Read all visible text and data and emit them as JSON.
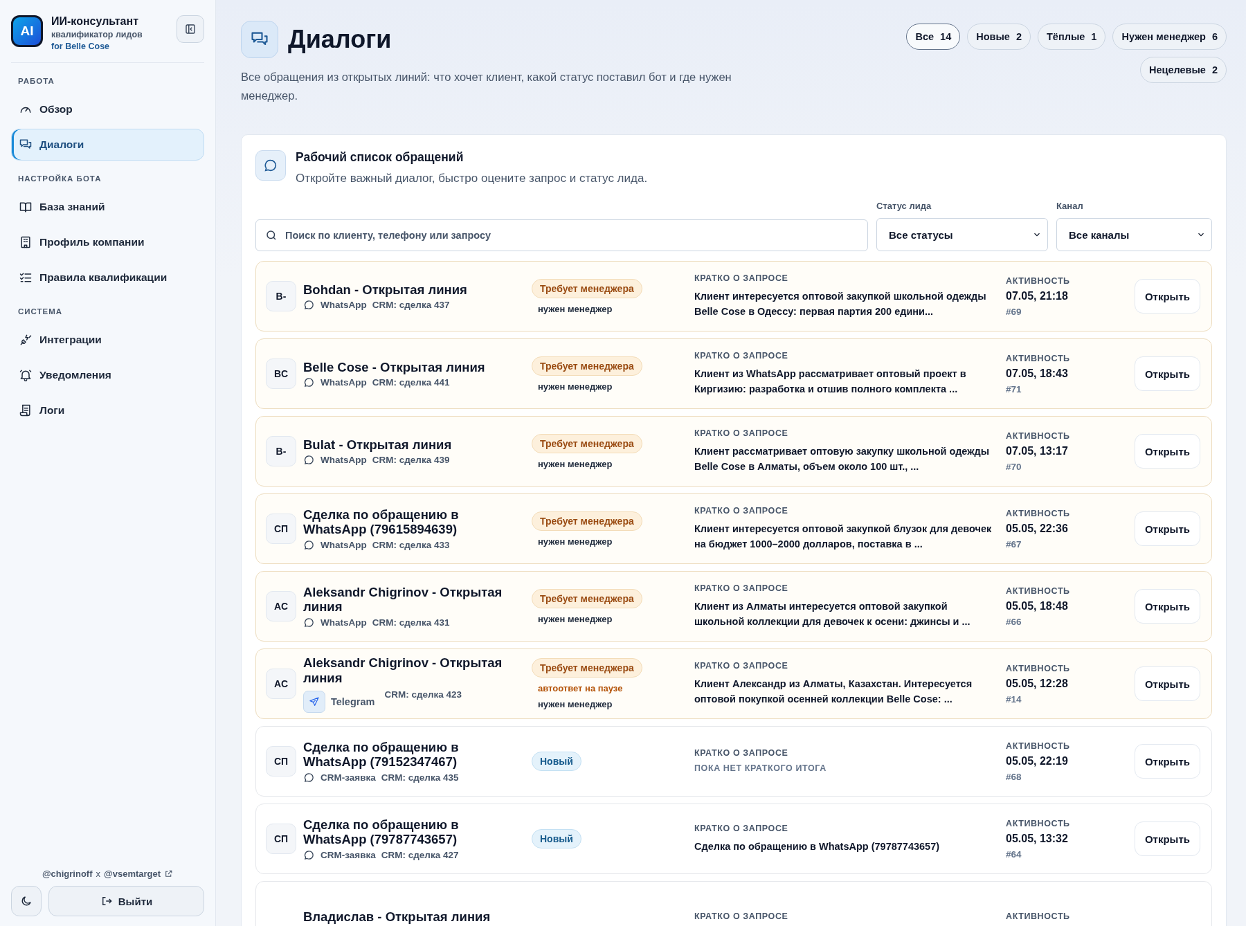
{
  "brand": {
    "badge": "AI",
    "title": "ИИ-консультант",
    "subtitle": "квалификатор лидов",
    "client": "for Belle Cose"
  },
  "sidebar": {
    "sections": [
      {
        "heading": "РАБОТА",
        "items": [
          {
            "label": "Обзор",
            "selected": false
          },
          {
            "label": "Диалоги",
            "selected": true
          }
        ]
      },
      {
        "heading": "НАСТРОЙКА БОТА",
        "items": [
          {
            "label": "База знаний",
            "selected": false
          },
          {
            "label": "Профиль компании",
            "selected": false
          },
          {
            "label": "Правила квалификации",
            "selected": false
          }
        ]
      },
      {
        "heading": "СИСТЕМА",
        "items": [
          {
            "label": "Интеграции",
            "selected": false
          },
          {
            "label": "Уведомления",
            "selected": false
          },
          {
            "label": "Логи",
            "selected": false
          }
        ]
      }
    ],
    "credits": {
      "left": "@chigrinoff",
      "sep": "x",
      "right": "@vsemtarget"
    },
    "logout": "Выйти"
  },
  "header": {
    "title": "Диалоги",
    "description": "Все обращения из открытых линий: что хочет клиент, какой статус поставил бот и где нужен менеджер."
  },
  "filters": [
    {
      "label": "Все",
      "count": "14",
      "selected": true
    },
    {
      "label": "Новые",
      "count": "2",
      "selected": false
    },
    {
      "label": "Тёплые",
      "count": "1",
      "selected": false
    },
    {
      "label": "Нужен менеджер",
      "count": "6",
      "selected": false
    },
    {
      "label": "Нецелевые",
      "count": "2",
      "selected": false
    }
  ],
  "panel": {
    "title": "Рабочий список обращений",
    "subtitle": "Откройте важный диалог, быстро оцените запрос и статус лида.",
    "search": {
      "placeholder": "Поиск по клиенту, телефону или запросу"
    },
    "status_filter": {
      "label": "Статус лида",
      "value": "Все статусы"
    },
    "channel_filter": {
      "label": "Канал",
      "value": "Все каналы"
    }
  },
  "rows": [
    {
      "initials": "B-",
      "name": "Bohdan - Открытая линия",
      "channel": {
        "kind": "chat",
        "label": "WhatsApp"
      },
      "crm": "CRM: сделка 437",
      "status": {
        "kind": "manager",
        "label": "Требует менеджера"
      },
      "notes": [
        {
          "kind": "plain",
          "text": "нужен менеджер"
        }
      ],
      "summary_label": "КРАТКО О ЗАПРОСЕ",
      "summary": "Клиент интересуется оптовой закупкой школьной одежды Belle Cose в Одессу: первая партия 200 едини...",
      "summary_missing": false,
      "activity_label": "АКТИВНОСТЬ",
      "time": "07.05, 21:18",
      "id": "#69",
      "action": "Открыть"
    },
    {
      "initials": "BC",
      "name": "Belle Cose - Открытая линия",
      "channel": {
        "kind": "chat",
        "label": "WhatsApp"
      },
      "crm": "CRM: сделка 441",
      "status": {
        "kind": "manager",
        "label": "Требует менеджера"
      },
      "notes": [
        {
          "kind": "plain",
          "text": "нужен менеджер"
        }
      ],
      "summary_label": "КРАТКО О ЗАПРОСЕ",
      "summary": "Клиент из WhatsApp рассматривает оптовый проект в Киргизию: разработка и отшив полного комплекта ...",
      "summary_missing": false,
      "activity_label": "АКТИВНОСТЬ",
      "time": "07.05, 18:43",
      "id": "#71",
      "action": "Открыть"
    },
    {
      "initials": "B-",
      "name": "Bulat - Открытая линия",
      "channel": {
        "kind": "chat",
        "label": "WhatsApp"
      },
      "crm": "CRM: сделка 439",
      "status": {
        "kind": "manager",
        "label": "Требует менеджера"
      },
      "notes": [
        {
          "kind": "plain",
          "text": "нужен менеджер"
        }
      ],
      "summary_label": "КРАТКО О ЗАПРОСЕ",
      "summary": "Клиент рассматривает оптовую закупку школьной одежды Belle Cose в Алматы, объем около 100 шт., ...",
      "summary_missing": false,
      "activity_label": "АКТИВНОСТЬ",
      "time": "07.05, 13:17",
      "id": "#70",
      "action": "Открыть"
    },
    {
      "initials": "СП",
      "name": "Сделка по обращению в WhatsApp (79615894639)",
      "channel": {
        "kind": "chat",
        "label": "WhatsApp"
      },
      "crm": "CRM: сделка 433",
      "status": {
        "kind": "manager",
        "label": "Требует менеджера"
      },
      "notes": [
        {
          "kind": "plain",
          "text": "нужен менеджер"
        }
      ],
      "summary_label": "КРАТКО О ЗАПРОСЕ",
      "summary": "Клиент интересуется оптовой закупкой блузок для девочек на бюджет 1000–2000 долларов, поставка в ...",
      "summary_missing": false,
      "activity_label": "АКТИВНОСТЬ",
      "time": "05.05, 22:36",
      "id": "#67",
      "action": "Открыть"
    },
    {
      "initials": "AC",
      "name": "Aleksandr Chigrinov - Открытая линия",
      "channel": {
        "kind": "chat",
        "label": "WhatsApp"
      },
      "crm": "CRM: сделка 431",
      "status": {
        "kind": "manager",
        "label": "Требует менеджера"
      },
      "notes": [
        {
          "kind": "plain",
          "text": "нужен менеджер"
        }
      ],
      "summary_label": "КРАТКО О ЗАПРОСЕ",
      "summary": "Клиент из Алматы интересуется оптовой закупкой школьной коллекции для девочек к осени: джинсы и ...",
      "summary_missing": false,
      "activity_label": "АКТИВНОСТЬ",
      "time": "05.05, 18:48",
      "id": "#66",
      "action": "Открыть"
    },
    {
      "initials": "AC",
      "name": "Aleksandr Chigrinov - Открытая линия",
      "channel": {
        "kind": "plane",
        "label": "Telegram"
      },
      "crm": "CRM: сделка 423",
      "status": {
        "kind": "manager",
        "label": "Требует менеджера"
      },
      "notes": [
        {
          "kind": "warn",
          "text": "автоответ на паузе"
        },
        {
          "kind": "plain",
          "text": "нужен менеджер"
        }
      ],
      "summary_label": "КРАТКО О ЗАПРОСЕ",
      "summary": "Клиент Александр из Алматы, Казахстан. Интересуется оптовой покупкой осенней коллекции Belle Cose: ...",
      "summary_missing": false,
      "activity_label": "АКТИВНОСТЬ",
      "time": "05.05, 12:28",
      "id": "#14",
      "action": "Открыть"
    },
    {
      "initials": "СП",
      "name": "Сделка по обращению в WhatsApp (79152347467)",
      "channel": {
        "kind": "chat",
        "label": "CRM-заявка"
      },
      "crm": "CRM: сделка 435",
      "status": {
        "kind": "new",
        "label": "Новый"
      },
      "summary_label": "КРАТКО О ЗАПРОСЕ",
      "summary": "ПОКА НЕТ КРАТКОГО ИТОГА",
      "summary_missing": true,
      "activity_label": "АКТИВНОСТЬ",
      "time": "05.05, 22:19",
      "id": "#68",
      "action": "Открыть"
    },
    {
      "initials": "СП",
      "name": "Сделка по обращению в WhatsApp (79787743657)",
      "channel": {
        "kind": "chat",
        "label": "CRM-заявка"
      },
      "crm": "CRM: сделка 427",
      "status": {
        "kind": "new",
        "label": "Новый"
      },
      "summary_label": "КРАТКО О ЗАПРОСЕ",
      "summary": "Сделка по обращению в WhatsApp (79787743657)",
      "summary_missing": false,
      "activity_label": "АКТИВНОСТЬ",
      "time": "05.05, 13:32",
      "id": "#64",
      "action": "Открыть"
    },
    {
      "name": "Владислав - Открытая линия",
      "summary_label": "КРАТКО О ЗАПРОСЕ",
      "activity_label": "АКТИВНОСТЬ"
    }
  ]
}
